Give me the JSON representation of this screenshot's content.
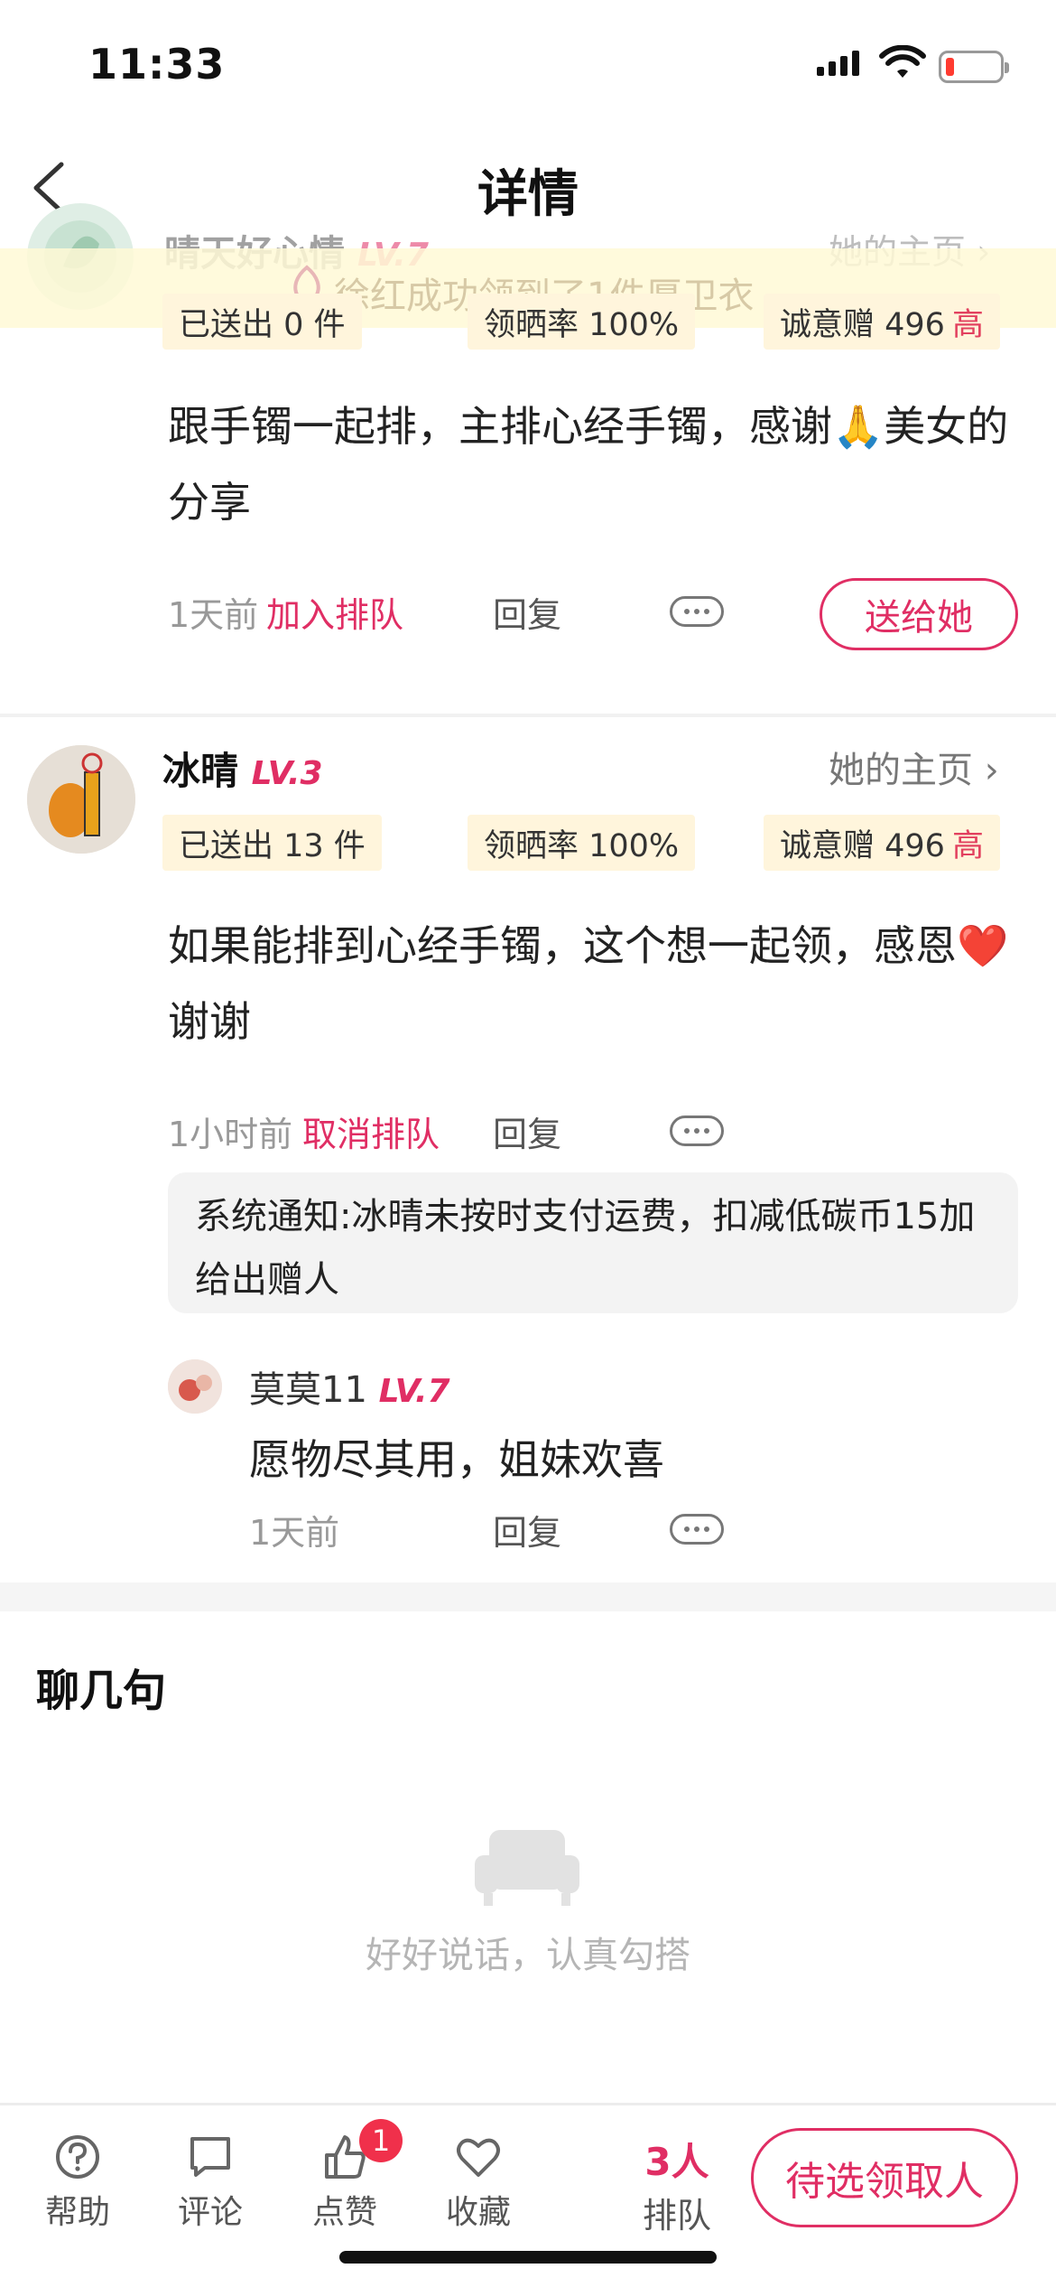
{
  "status_bar": {
    "time": "11:33"
  },
  "nav": {
    "title": "详情"
  },
  "toast": {
    "text": "徐红成功领到了1件厚卫衣"
  },
  "comment1": {
    "name": "晴天好心情",
    "level": "LV.7",
    "home_link": "她的主页",
    "chips": {
      "sent": "已送出 0 件",
      "rate": "领晒率 100%",
      "sincerity": "诚意赠 496",
      "sincerity_level": "高"
    },
    "text": "跟手镯一起排，主排心经手镯，感谢🙏美女的分享",
    "time": "1天前",
    "action": "加入排队",
    "reply": "回复",
    "send_button": "送给她"
  },
  "comment2": {
    "name": "冰晴",
    "level": "LV.3",
    "home_link": "她的主页",
    "chips": {
      "sent": "已送出 13 件",
      "rate": "领晒率 100%",
      "sincerity": "诚意赠 496",
      "sincerity_level": "高"
    },
    "text": "如果能排到心经手镯，这个想一起领，感恩❤️谢谢",
    "time": "1小时前",
    "action": "取消排队",
    "reply": "回复",
    "notice": "系统通知:冰晴未按时支付运费，扣减低碳币15加给出赠人",
    "sub_reply": {
      "name": "莫莫11",
      "level": "LV.7",
      "text": "愿物尽其用，姐妹欢喜",
      "time": "1天前",
      "reply": "回复"
    }
  },
  "chat": {
    "title": "聊几句",
    "empty_text": "好好说话，认真勾搭"
  },
  "bottom_bar": {
    "help": "帮助",
    "comment": "评论",
    "like": "点赞",
    "like_badge": "1",
    "favorite": "收藏",
    "queue_count": "3人",
    "queue_label": "排队",
    "pick_button": "待选领取人"
  },
  "colors": {
    "accent": "#e02e64",
    "chip_bg": "#fff5dc",
    "badge": "#f0304b"
  }
}
